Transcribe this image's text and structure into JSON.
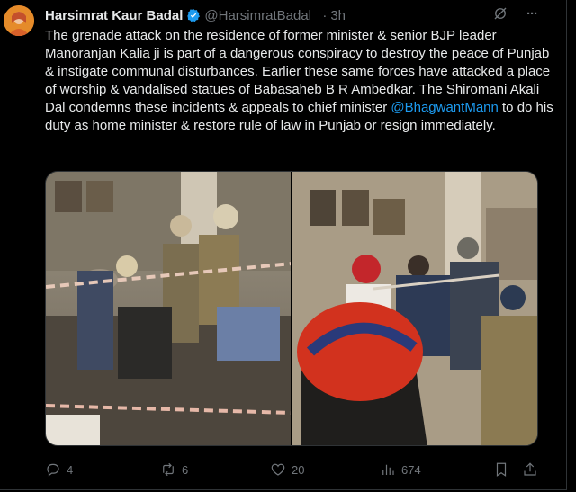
{
  "tweet": {
    "author_name": "Harsimrat Kaur Badal",
    "handle": "@HarsimratBadal_",
    "separator": "·",
    "time": "3h",
    "text_before_mention": "The grenade attack on the residence of former minister & senior BJP leader Manoranjan Kalia ji is part of a dangerous conspiracy to destroy the peace of Punjab & instigate communal disturbances. Earlier these same forces have attacked a place of worship & vandalised statues of Babasaheb B R Ambedkar. The Shiromani Akali Dal condemns these incidents & appeals to chief minister ",
    "mention": "@BhagwantMann",
    "text_after_mention": " to do his duty as home minister & restore rule of law in Punjab or resign immediately.",
    "more_label": "···"
  },
  "metrics": {
    "replies": "4",
    "reposts": "6",
    "likes": "20",
    "views": "674"
  },
  "icons": {
    "verified": "verified-badge-icon",
    "grok": "grok-icon",
    "more": "more-icon",
    "reply": "reply-icon",
    "repost": "repost-icon",
    "like": "heart-icon",
    "views": "views-icon",
    "bookmark": "bookmark-icon",
    "share": "share-icon"
  },
  "colors": {
    "background": "#000000",
    "text": "#e7e9ea",
    "muted": "#71767b",
    "accent": "#1d9bf0"
  }
}
